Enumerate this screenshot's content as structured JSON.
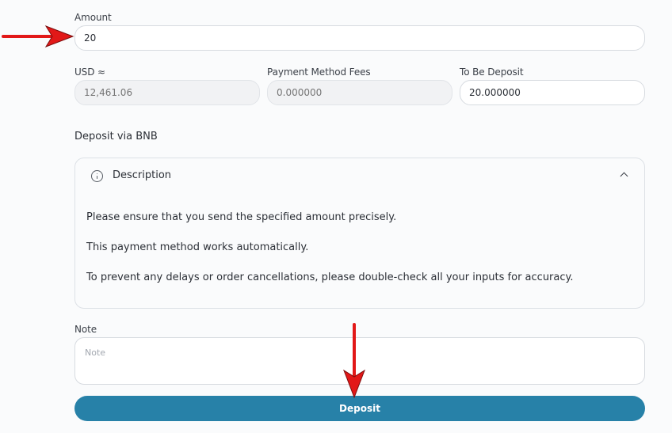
{
  "amount": {
    "label": "Amount",
    "value": "20"
  },
  "usd": {
    "label": "USD ≈",
    "placeholder": "12,461.06"
  },
  "fees": {
    "label": "Payment Method Fees",
    "placeholder": "0.000000"
  },
  "to_be_deposit": {
    "label": "To Be Deposit",
    "value": "20.000000"
  },
  "deposit_via": "Deposit via BNB",
  "description": {
    "title": "Description",
    "lines": [
      "Please ensure that you send the specified amount precisely.",
      "This payment method works automatically.",
      "To prevent any delays or order cancellations, please double-check all your inputs for accuracy."
    ]
  },
  "note": {
    "label": "Note",
    "placeholder": "Note"
  },
  "deposit_button": "Deposit",
  "colors": {
    "button": "#2781a8",
    "annotation_arrow": "#e21818"
  }
}
